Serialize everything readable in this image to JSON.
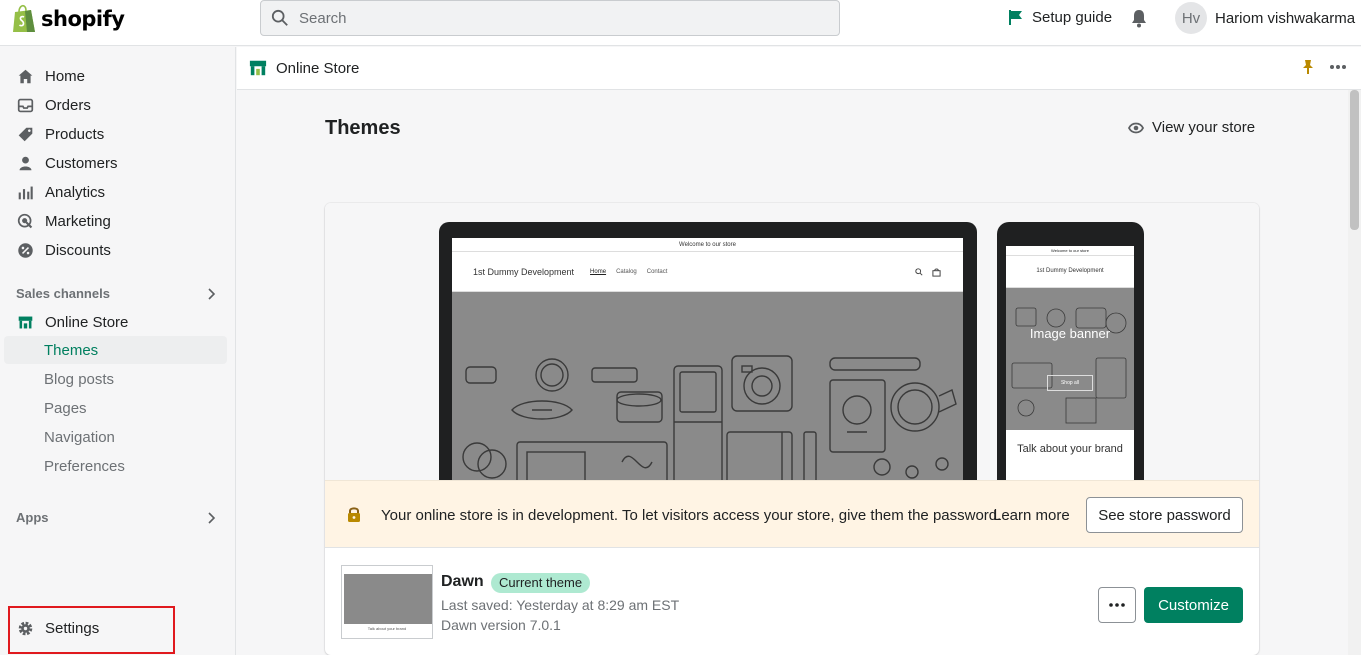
{
  "topbar": {
    "brand": "shopify",
    "search_placeholder": "Search",
    "setup_guide": "Setup guide",
    "user_initials": "Hv",
    "user_name": "Hariom vishwakarma"
  },
  "sidebar": {
    "items": [
      {
        "label": "Home",
        "icon": "home-icon"
      },
      {
        "label": "Orders",
        "icon": "orders-icon"
      },
      {
        "label": "Products",
        "icon": "products-icon"
      },
      {
        "label": "Customers",
        "icon": "customers-icon"
      },
      {
        "label": "Analytics",
        "icon": "analytics-icon"
      },
      {
        "label": "Marketing",
        "icon": "marketing-icon"
      },
      {
        "label": "Discounts",
        "icon": "discounts-icon"
      }
    ],
    "sales_channels_label": "Sales channels",
    "online_store": "Online Store",
    "sub_items": [
      {
        "label": "Themes",
        "active": true
      },
      {
        "label": "Blog posts",
        "active": false
      },
      {
        "label": "Pages",
        "active": false
      },
      {
        "label": "Navigation",
        "active": false
      },
      {
        "label": "Preferences",
        "active": false
      }
    ],
    "apps_label": "Apps",
    "settings": "Settings"
  },
  "page_header": {
    "title": "Online Store"
  },
  "main": {
    "title": "Themes",
    "view_store": "View your store"
  },
  "preview": {
    "desktop_announcement": "Welcome to our store",
    "desktop_store_name": "1st Dummy Development",
    "desktop_nav": [
      "Home",
      "Catalog",
      "Contact"
    ],
    "mobile_announcement": "Welcome to our store",
    "mobile_store_name": "1st Dummy Development",
    "mobile_hero_title": "Image banner",
    "mobile_shop_all": "Shop all",
    "mobile_talk": "Talk about your brand"
  },
  "banner": {
    "text": "Your online store is in development. To let visitors access your store, give them the password.",
    "learn_more": "Learn more",
    "see_password": "See store password"
  },
  "theme": {
    "name": "Dawn",
    "badge": "Current theme",
    "last_saved": "Last saved: Yesterday at 8:29 am EST",
    "version": "Dawn version 7.0.1",
    "customize": "Customize"
  },
  "colors": {
    "accent": "#008060",
    "badge_bg": "#aee9d1",
    "banner_bg": "#fff4e4",
    "highlight_border": "#e0191e"
  }
}
